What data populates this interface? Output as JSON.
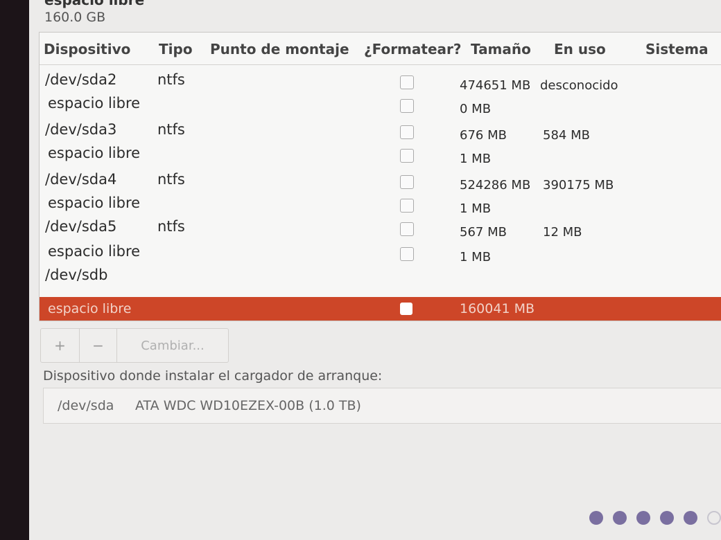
{
  "header": {
    "partition_label": "espacio libre",
    "partition_size": "160.0 GB"
  },
  "table": {
    "columns": [
      "Dispositivo",
      "Tipo",
      "Punto de montaje",
      "¿Formatear?",
      "Tamaño",
      "En uso",
      "Sistema"
    ],
    "rows": [
      {
        "device": "/dev/sda2",
        "type": "ntfs",
        "mount": "",
        "format": false,
        "size": "474651 MB",
        "used": "desconocido",
        "system": ""
      },
      {
        "device": "espacio libre",
        "type": "",
        "mount": "",
        "format": false,
        "size": "0 MB",
        "used": "",
        "system": ""
      },
      {
        "device": "/dev/sda3",
        "type": "ntfs",
        "mount": "",
        "format": false,
        "size": "676 MB",
        "used": "584 MB",
        "system": ""
      },
      {
        "device": "espacio libre",
        "type": "",
        "mount": "",
        "format": false,
        "size": "1 MB",
        "used": "",
        "system": ""
      },
      {
        "device": "/dev/sda4",
        "type": "ntfs",
        "mount": "",
        "format": false,
        "size": "524286 MB",
        "used": "390175 MB",
        "system": ""
      },
      {
        "device": "espacio libre",
        "type": "",
        "mount": "",
        "format": false,
        "size": "1 MB",
        "used": "",
        "system": ""
      },
      {
        "device": "/dev/sda5",
        "type": "ntfs",
        "mount": "",
        "format": false,
        "size": "567 MB",
        "used": "12 MB",
        "system": ""
      },
      {
        "device": "espacio libre",
        "type": "",
        "mount": "",
        "format": false,
        "size": "1 MB",
        "used": "",
        "system": ""
      },
      {
        "device": "/dev/sdb",
        "type": "",
        "mount": "",
        "format": null,
        "size": "",
        "used": "",
        "system": ""
      },
      {
        "device": "espacio libre",
        "type": "",
        "mount": "",
        "format": false,
        "size": "160041 MB",
        "used": "",
        "system": "",
        "selected": true
      }
    ]
  },
  "toolbar": {
    "add_label": "+",
    "remove_label": "−",
    "change_label": "Cambiar..."
  },
  "bootloader": {
    "label": "Dispositivo donde instalar el cargador de arranque:",
    "device": "/dev/sda",
    "description": "ATA WDC WD10EZEX-00B (1.0 TB)"
  },
  "progress": {
    "total_steps": 6,
    "completed_steps": 5
  },
  "colors": {
    "selection": "#cd4628",
    "progress_dot": "#7a6fa0"
  }
}
